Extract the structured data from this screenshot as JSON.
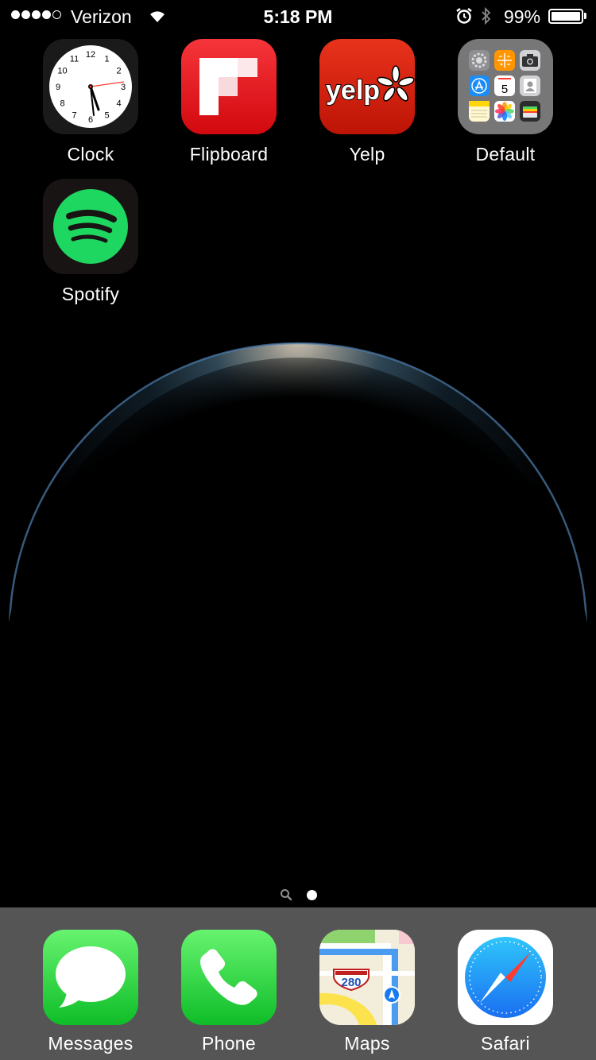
{
  "status_bar": {
    "carrier": "Verizon",
    "signal_bars_filled": 4,
    "signal_bars_total": 5,
    "time": "5:18 PM",
    "battery_percent": "99%",
    "battery_level": 0.99,
    "icons": [
      "signal-icon",
      "wifi-icon",
      "alarm-icon",
      "bluetooth-icon",
      "battery-icon"
    ]
  },
  "apps": [
    {
      "label": "Clock",
      "icon": "clock-icon"
    },
    {
      "label": "Flipboard",
      "icon": "flipboard-icon"
    },
    {
      "label": "Yelp",
      "icon": "yelp-icon"
    },
    {
      "label": "Default",
      "icon": "folder-icon"
    },
    {
      "label": "Spotify",
      "icon": "spotify-icon"
    }
  ],
  "clock_face": {
    "numerals": [
      "12",
      "1",
      "2",
      "3",
      "4",
      "5",
      "6",
      "7",
      "8",
      "9",
      "10",
      "11"
    ]
  },
  "yelp_wordmark": "yelp",
  "folder_contents": [
    "settings",
    "calculator",
    "camera",
    "app-store",
    "calendar",
    "contacts",
    "notes",
    "photos",
    "wallet"
  ],
  "calendar_mini": {
    "day": "5"
  },
  "page_indicator": {
    "pages": 1,
    "current": 1,
    "has_spotlight": true
  },
  "dock": [
    {
      "label": "Messages",
      "icon": "messages-icon"
    },
    {
      "label": "Phone",
      "icon": "phone-icon"
    },
    {
      "label": "Maps",
      "icon": "maps-icon"
    },
    {
      "label": "Safari",
      "icon": "safari-icon"
    }
  ],
  "maps_shield": "280",
  "colors": {
    "spotify_green": "#1ed760",
    "flipboard_red": "#e3141b",
    "yelp_red": "#d32323",
    "ios_green": "#33d74a",
    "safari_blue": "#1a8dfa"
  }
}
